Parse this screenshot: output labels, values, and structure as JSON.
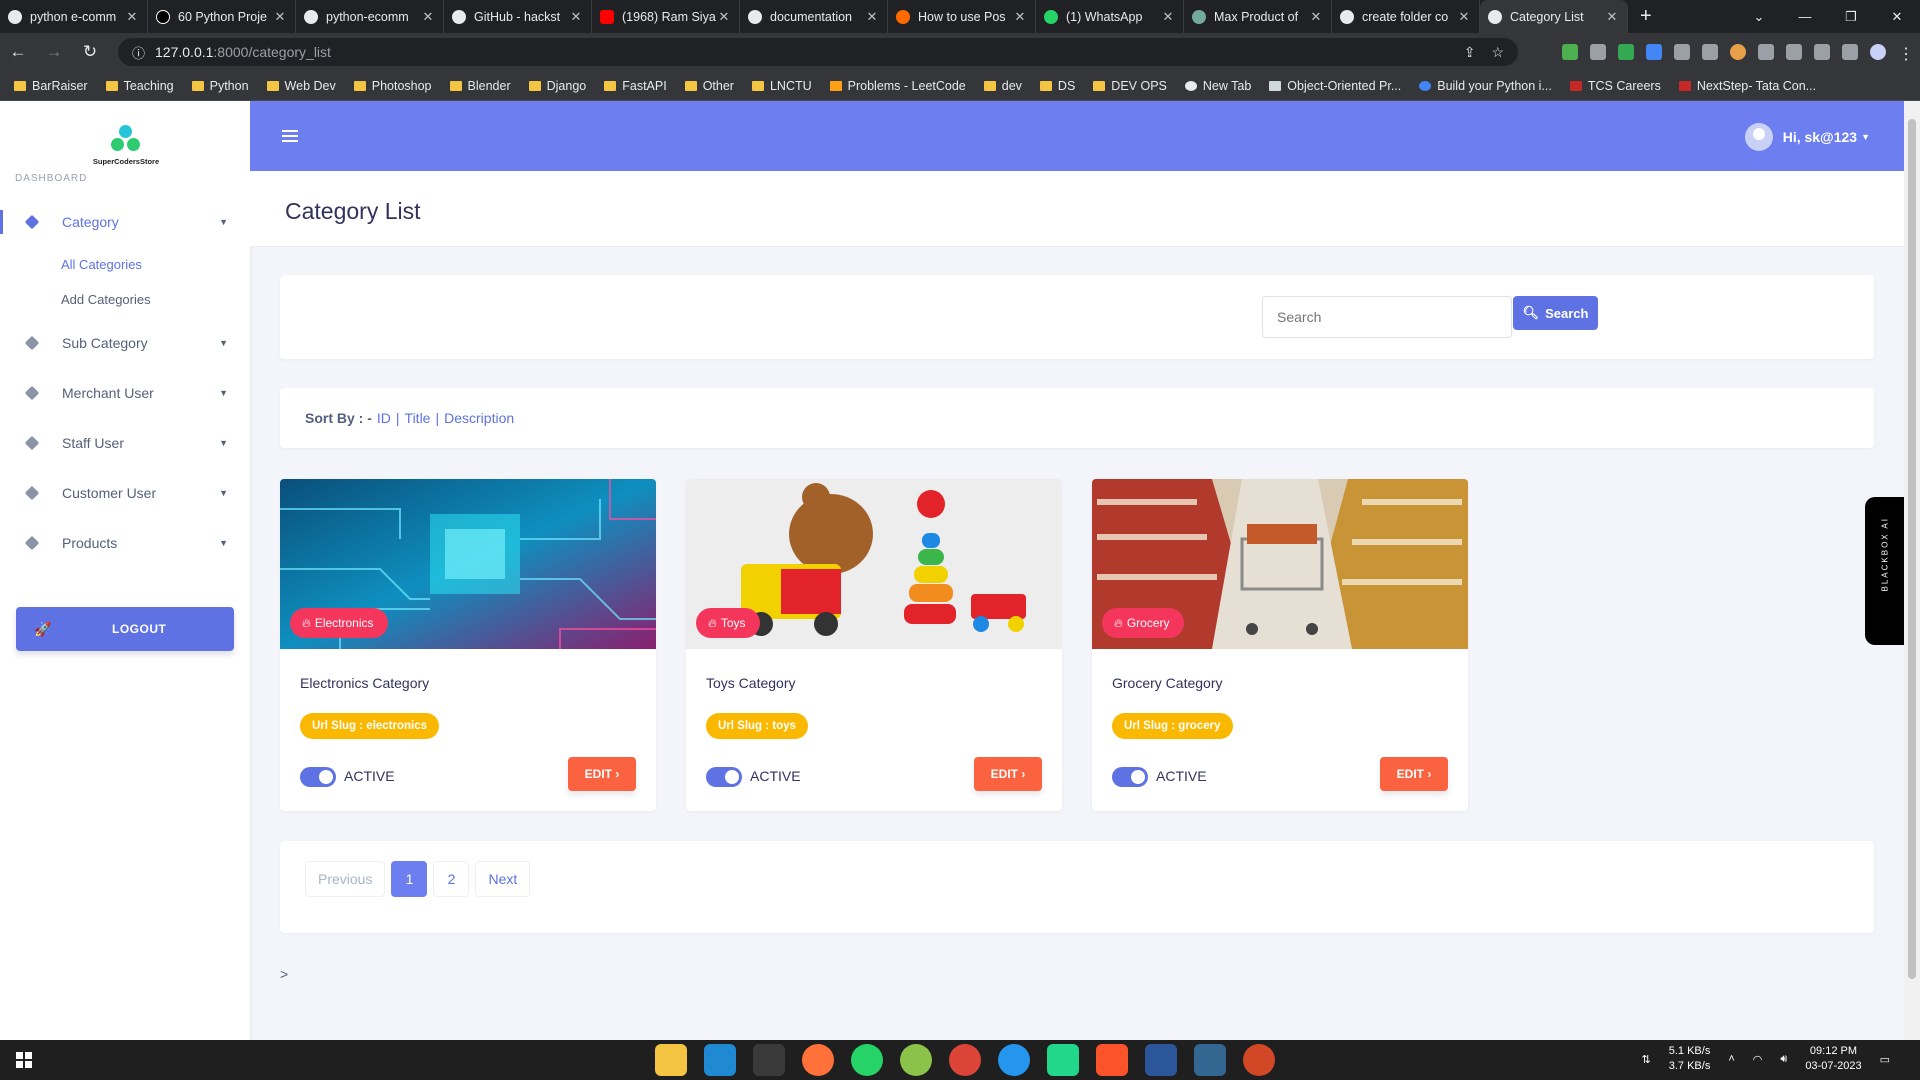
{
  "browser": {
    "tabs": [
      {
        "label": "python e-comm",
        "color": "#e8eaed"
      },
      {
        "label": "60 Python Proje",
        "color": "#000000"
      },
      {
        "label": "python-ecomm",
        "color": "#e8eaed"
      },
      {
        "label": "GitHub - hackst",
        "color": "#e8eaed"
      },
      {
        "label": "(1968) Ram Siya",
        "color": "#ff0000"
      },
      {
        "label": "documentation",
        "color": "#e8eaed"
      },
      {
        "label": "How to use Pos",
        "color": "#ff6a00"
      },
      {
        "label": "(1) WhatsApp",
        "color": "#25d366"
      },
      {
        "label": "Max Product of",
        "color": "#74aa9c"
      },
      {
        "label": "create folder co",
        "color": "#e8eaed"
      },
      {
        "label": "Category List",
        "color": "#e8eaed"
      }
    ],
    "url_host": "127.0.0.1",
    "url_path": ":8000/category_list",
    "bookmarks": [
      "BarRaiser",
      "Teaching",
      "Python",
      "Web Dev",
      "Photoshop",
      "Blender",
      "Django",
      "FastAPI",
      "Other",
      "LNCTU",
      "Problems - LeetCode",
      "dev",
      "DS",
      "DEV OPS",
      "New Tab",
      "Object-Oriented Pr...",
      "Build your Python i...",
      "TCS Careers",
      "NextStep- Tata Con..."
    ]
  },
  "sidebar": {
    "brand": "SuperCodersStore",
    "section_label": "DASHBOARD",
    "items": [
      {
        "label": "Category"
      },
      {
        "label": "Sub Category"
      },
      {
        "label": "Merchant User"
      },
      {
        "label": "Staff User"
      },
      {
        "label": "Customer User"
      },
      {
        "label": "Products"
      }
    ],
    "submenu": [
      "All Categories",
      "Add Categories"
    ],
    "logout_label": "LOGOUT"
  },
  "topbar": {
    "greeting": "Hi, sk@123"
  },
  "page": {
    "title": "Category List"
  },
  "search": {
    "placeholder": "Search",
    "button_label": "Search"
  },
  "sort": {
    "label": "Sort By : -",
    "options": [
      "ID",
      "Title",
      "Description"
    ]
  },
  "cards": [
    {
      "badge": "Electronics",
      "title": "Electronics Category",
      "slug": "Url Slug : electronics",
      "status": "ACTIVE",
      "edit": "EDIT"
    },
    {
      "badge": "Toys",
      "title": "Toys Category",
      "slug": "Url Slug : toys",
      "status": "ACTIVE",
      "edit": "EDIT"
    },
    {
      "badge": "Grocery",
      "title": "Grocery Category",
      "slug": "Url Slug : grocery",
      "status": "ACTIVE",
      "edit": "EDIT"
    }
  ],
  "pagination": {
    "previous": "Previous",
    "pages": [
      "1",
      "2"
    ],
    "next": "Next"
  },
  "stray_text": ">",
  "blackbox": {
    "label": "BLACKBOX AI"
  },
  "taskbar": {
    "net_down": "5.1 KB/s",
    "net_up": "3.7 KB/s",
    "time": "09:12 PM",
    "date": "03-07-2023"
  },
  "colors": {
    "primary": "#5e72e4",
    "topbar": "#6d7ff0",
    "badge": "#f5365c",
    "slug": "#fbb800",
    "edit": "#fb6340"
  }
}
